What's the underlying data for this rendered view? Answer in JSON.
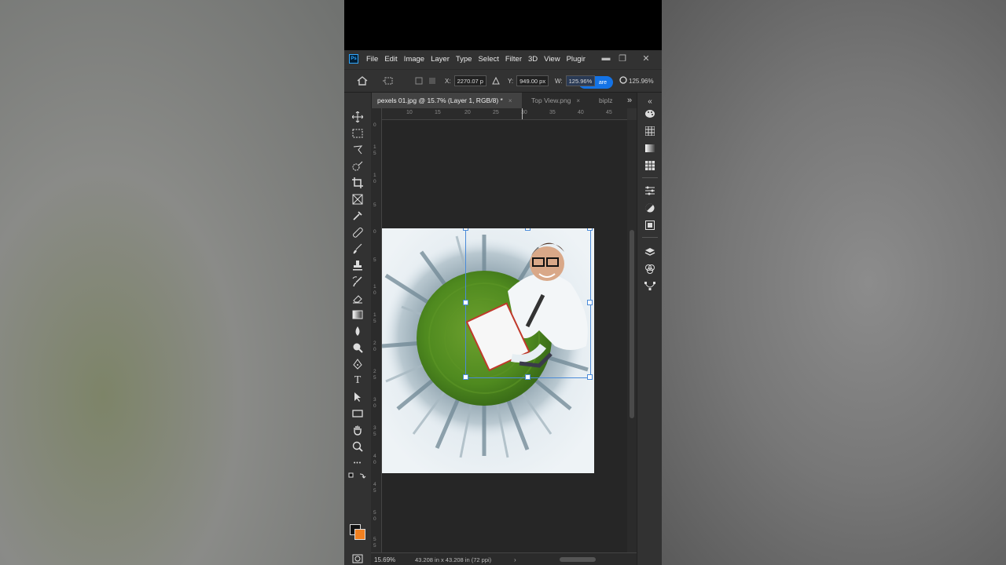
{
  "app": {
    "logo": "Ps"
  },
  "menu": [
    "File",
    "Edit",
    "Image",
    "Layer",
    "Type",
    "Select",
    "Filter",
    "3D",
    "View",
    "Plugir"
  ],
  "window_controls": {
    "minimize": "▬",
    "restore": "❐",
    "close": "✕"
  },
  "options": {
    "x_label": "X:",
    "x_value": "2270.07 p",
    "y_label": "Y:",
    "y_value": "949.00 px",
    "w_label": "W:",
    "w_value": "125.96%",
    "share_label": "are",
    "h_value": "125.96%"
  },
  "tabs": [
    {
      "label": "pexels 01.jpg @ 15.7% (Layer 1, RGB/8) *",
      "close": "×"
    },
    {
      "label": "Top View.png",
      "close": "×"
    },
    {
      "label": "biplz",
      "close": ""
    }
  ],
  "tabs_overflow": "»",
  "ruler_top": [
    "10",
    "15",
    "20",
    "25",
    "30",
    "35",
    "40",
    "45"
  ],
  "ruler_left": [
    "0",
    "1 5",
    "1 0",
    "5",
    "0",
    "5",
    "1 0",
    "1 5",
    "2 0",
    "2 5",
    "3 0",
    "3 5",
    "4 0",
    "4 5",
    "5 0",
    "5 5"
  ],
  "status": {
    "zoom": "15.69%",
    "doc_size": "43.208 in x 43.208 in (72 ppi)",
    "arrow": "›"
  },
  "colors": {
    "foreground": "#111111",
    "background": "#f08020",
    "accent": "#1473e6"
  },
  "tools": [
    "move-icon",
    "marquee-icon",
    "lasso-icon",
    "quick-select-icon",
    "crop-icon",
    "frame-icon",
    "eyedropper-icon",
    "healing-icon",
    "brush-icon",
    "stamp-icon",
    "history-brush-icon",
    "eraser-icon",
    "gradient-icon",
    "blur-icon",
    "dodge-icon",
    "pen-icon",
    "type-icon",
    "path-select-icon",
    "rectangle-icon",
    "hand-icon",
    "zoom-icon",
    "more-tools-icon"
  ],
  "tool_glyphs": {
    "type": "T",
    "more": "•••"
  }
}
